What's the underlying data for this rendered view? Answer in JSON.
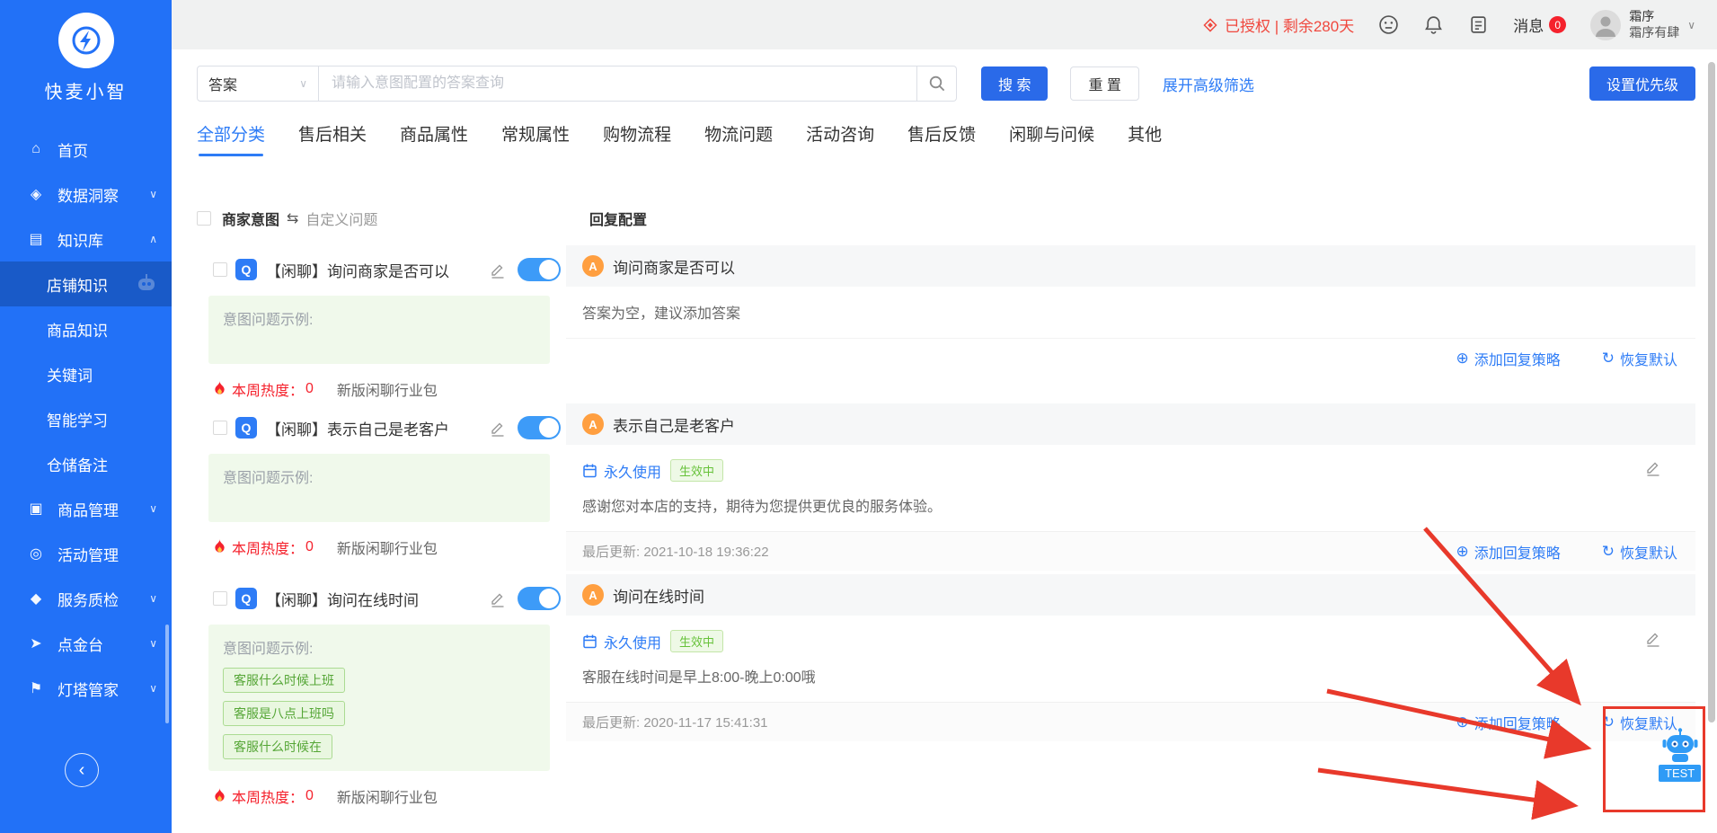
{
  "app": {
    "title": "快麦小智"
  },
  "icons": {
    "home": "⌂",
    "data_insight": "◈",
    "knowledge": "▤",
    "product": "▣",
    "activity": "◎",
    "quality": "◆",
    "dianjintai": "➤",
    "lighthouse": "⚑",
    "chevron_down": "∨",
    "chevron_up": "∧",
    "collapse": "‹",
    "swap": "⇆",
    "add": "⊕",
    "restore": "↻"
  },
  "badges": {
    "q": "Q",
    "a": "A"
  },
  "sidebar": {
    "items": [
      {
        "label": "首页"
      },
      {
        "label": "数据洞察"
      },
      {
        "label": "知识库"
      },
      {
        "label": "店铺知识"
      },
      {
        "label": "商品知识"
      },
      {
        "label": "关键词"
      },
      {
        "label": "智能学习"
      },
      {
        "label": "仓储备注"
      },
      {
        "label": "商品管理"
      },
      {
        "label": "活动管理"
      },
      {
        "label": "服务质检"
      },
      {
        "label": "点金台"
      },
      {
        "label": "灯塔管家"
      }
    ]
  },
  "topbar": {
    "license_text": "已授权 | 剩余280天",
    "messages_label": "消息",
    "messages_badge": "0",
    "user_line1": "霜序",
    "user_line2": "霜序有肆"
  },
  "search": {
    "field_selector": "答案",
    "placeholder": "请输入意图配置的答案查询",
    "search_button": "搜 索",
    "reset_button": "重 置",
    "advanced_filter": "展开高级筛选",
    "priority_button": "设置优先级"
  },
  "tabs": [
    {
      "label": "全部分类",
      "active": true
    },
    {
      "label": "售后相关"
    },
    {
      "label": "商品属性"
    },
    {
      "label": "常规属性"
    },
    {
      "label": "购物流程"
    },
    {
      "label": "物流问题"
    },
    {
      "label": "活动咨询"
    },
    {
      "label": "售后反馈"
    },
    {
      "label": "闲聊与问候"
    },
    {
      "label": "其他"
    }
  ],
  "list_header": {
    "col_intent": "商家意图",
    "col_custom": "自定义问题",
    "col_reply": "回复配置"
  },
  "rows": [
    {
      "intent": {
        "title": "【闲聊】询问商家是否可以",
        "examples_label": "意图问题示例:",
        "heat_label": "本周热度：",
        "heat_value": "0",
        "package": "新版闲聊行业包"
      },
      "reply": {
        "name": "询问商家是否可以",
        "empty_hint": "答案为空，建议添加答案",
        "add_strategy_label": "添加回复策略",
        "restore_label": "恢复默认"
      }
    },
    {
      "intent": {
        "title": "【闲聊】表示自己是老客户",
        "examples_label": "意图问题示例:",
        "heat_label": "本周热度：",
        "heat_value": "0",
        "package": "新版闲聊行业包"
      },
      "reply": {
        "name": "表示自己是老客户",
        "validity_label": "永久使用",
        "status_label": "生效中",
        "content": "感谢您对本店的支持，期待为您提供更优良的服务体验。",
        "updated": "最后更新: 2021-10-18 19:36:22",
        "add_strategy_label": "添加回复策略",
        "restore_label": "恢复默认"
      }
    },
    {
      "intent": {
        "title": "【闲聊】询问在线时间",
        "examples_label": "意图问题示例:",
        "example_tags": [
          "客服什么时候上班",
          "客服是八点上班吗",
          "客服什么时候在"
        ],
        "heat_label": "本周热度：",
        "heat_value": "0",
        "package": "新版闲聊行业包"
      },
      "reply": {
        "name": "询问在线时间",
        "validity_label": "永久使用",
        "status_label": "生效中",
        "content": "客服在线时间是早上8:00-晚上0:00哦",
        "updated": "最后更新: 2020-11-17 15:41:31",
        "add_strategy_label": "添加回复策略",
        "restore_label": "恢复默认"
      }
    }
  ],
  "floating": {
    "test_label": "TEST"
  },
  "colors": {
    "sidebar_blue": "#2271f7",
    "accent_blue": "#2e7cf6",
    "button_blue": "#2a6ae9",
    "danger_red": "#f5222d",
    "success_green": "#67c23a",
    "annotation_red": "#e8392b",
    "badge_orange": "#ff9f40"
  }
}
